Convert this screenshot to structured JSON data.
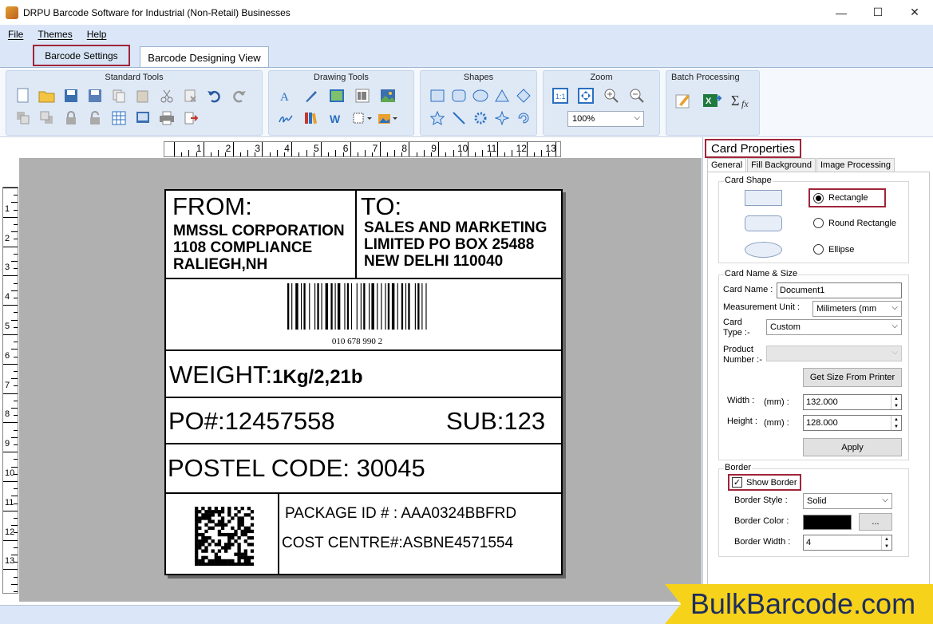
{
  "window": {
    "title": "DRPU Barcode Software for Industrial (Non-Retail) Businesses",
    "minimize": "—",
    "maximize": "☐",
    "close": "✕"
  },
  "menu": {
    "file": "File",
    "themes": "Themes",
    "help": "Help"
  },
  "tabs": {
    "settings": "Barcode Settings",
    "design": "Barcode Designing View"
  },
  "ribbon": {
    "standard_tools": "Standard Tools",
    "drawing_tools": "Drawing Tools",
    "shapes": "Shapes",
    "zoom": "Zoom",
    "zoom_value": "100%",
    "batch_processing": "Batch Processing"
  },
  "rulers": {
    "h": [
      "1",
      "2",
      "3",
      "4",
      "5",
      "6",
      "7",
      "8",
      "9",
      "10",
      "11",
      "12",
      "13"
    ],
    "v": [
      "1",
      "2",
      "3",
      "4",
      "5",
      "6",
      "7",
      "8",
      "9",
      "10",
      "11",
      "12",
      "13"
    ]
  },
  "label": {
    "from_title": "FROM:",
    "from_lines": [
      "MMSSL CORPORATION",
      "1108 COMPLIANCE",
      "RALIEGH,NH"
    ],
    "to_title": "TO:",
    "to_lines": [
      "SALES AND MARKETING",
      "LIMITED PO BOX 25488",
      "NEW DELHI 110040"
    ],
    "barcode_text": "010 678 990 2",
    "weight_label": "WEIGHT:",
    "weight_value": "1Kg/2,21b",
    "po": "PO#:12457558",
    "sub": "SUB:123",
    "postal": "POSTEL CODE: 30045",
    "package_id": "PACKAGE ID # : AAA0324BBFRD",
    "cost_centre": "COST CENTRE#:ASBNE4571554"
  },
  "panel": {
    "title": "Card Properties",
    "tabs": [
      "General",
      "Fill Background",
      "Image Processing"
    ],
    "card_shape": {
      "legend": "Card Shape",
      "options": [
        "Rectangle",
        "Round Rectangle",
        "Ellipse"
      ],
      "selected": "Rectangle"
    },
    "name_size": {
      "legend": "Card  Name & Size",
      "card_name_label": "Card Name :",
      "card_name_value": "Document1",
      "unit_label": "Measurement Unit :",
      "unit_value": "Milimeters (mm",
      "type_label_1": "Card",
      "type_label_2": "Type :-",
      "type_value": "Custom",
      "product_label_1": "Product",
      "product_label_2": "Number :-",
      "get_size_button": "Get Size From Printer",
      "width_label": "Width :",
      "width_unit": "(mm) :",
      "width_value": "132.000",
      "height_label": "Height :",
      "height_unit": "(mm) :",
      "height_value": "128.000",
      "apply_button": "Apply"
    },
    "border": {
      "legend": "Border",
      "show_border": "Show Border",
      "show_border_checked": true,
      "style_label": "Border Style :",
      "style_value": "Solid",
      "color_label": "Border Color :",
      "color_value": "#000000",
      "color_button": "...",
      "width_label": "Border Width :",
      "width_value": "4"
    }
  },
  "brand": "BulkBarcode.com"
}
